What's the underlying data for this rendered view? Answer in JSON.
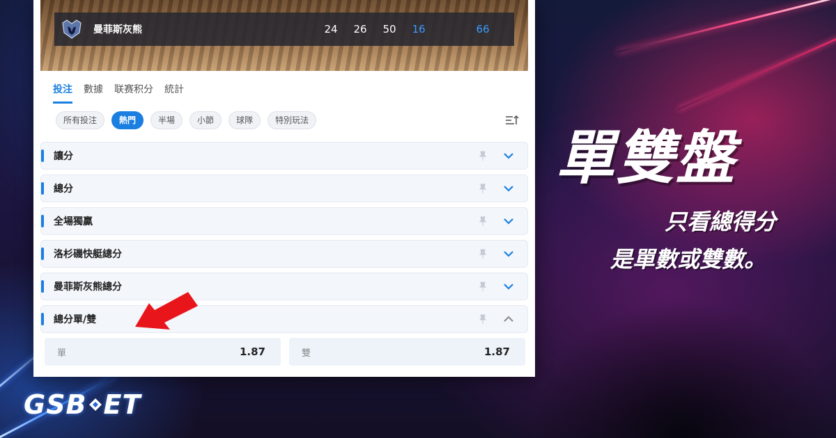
{
  "game": {
    "team_name": "曼菲斯灰熊",
    "scores": [
      "24",
      "26",
      "50",
      "16"
    ],
    "total": "66"
  },
  "tabs": [
    {
      "label": "投注"
    },
    {
      "label": "數據"
    },
    {
      "label": "联赛积分"
    },
    {
      "label": "統計"
    }
  ],
  "filters": [
    {
      "label": "所有投注"
    },
    {
      "label": "熱門"
    },
    {
      "label": "半場"
    },
    {
      "label": "小節"
    },
    {
      "label": "球隊"
    },
    {
      "label": "特別玩法"
    }
  ],
  "markets": [
    {
      "name": "讓分"
    },
    {
      "name": "總分"
    },
    {
      "name": "全場獨贏"
    },
    {
      "name": "洛杉磯快艇總分"
    },
    {
      "name": "曼菲斯灰熊總分"
    },
    {
      "name": "總分單/雙"
    }
  ],
  "odds": [
    {
      "label": "單",
      "value": "1.87"
    },
    {
      "label": "雙",
      "value": "1.87"
    }
  ],
  "headline": "單雙盤",
  "sub_line1": "只看總得分",
  "sub_line2": "是單數或雙數。",
  "brand": {
    "prefix": "GSB",
    "suffix": "ET"
  },
  "colors": {
    "accent": "#1a7fe0",
    "arrow": "#e8161b",
    "score_highlight": "#3b9bff"
  }
}
